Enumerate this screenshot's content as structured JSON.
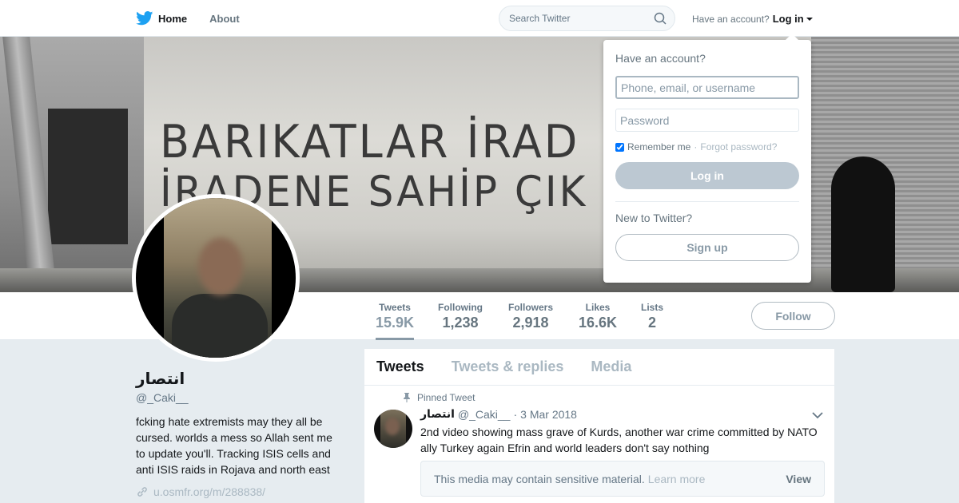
{
  "nav": {
    "home_label": "Home",
    "about_label": "About",
    "search_placeholder": "Search Twitter",
    "have_account": "Have an account?",
    "login_label": "Log in"
  },
  "banner": {
    "graffiti_line1": "BARIKATLAR İRAD",
    "graffiti_line2": "İRADENE SAHİP ÇIK"
  },
  "profile": {
    "display_name": "انتصار",
    "handle": "@_Caki__",
    "bio": "fcking hate extremists may they all be cursed. worlds a mess so Allah sent me to update you'll. Tracking ISIS cells and anti ISIS raids in Rojava and north east",
    "link": "u.osmfr.org/m/288838/"
  },
  "stats": [
    {
      "label": "Tweets",
      "value": "15.9K"
    },
    {
      "label": "Following",
      "value": "1,238"
    },
    {
      "label": "Followers",
      "value": "2,918"
    },
    {
      "label": "Likes",
      "value": "16.6K"
    },
    {
      "label": "Lists",
      "value": "2"
    }
  ],
  "follow_label": "Follow",
  "timeline": {
    "tabs": [
      "Tweets",
      "Tweets & replies",
      "Media"
    ],
    "pinned_label": "Pinned Tweet",
    "tweet": {
      "name": "انتصار",
      "handle": "@_Caki__",
      "date": "3 Mar 2018",
      "text": "2nd video showing mass grave of Kurds, another war crime committed by NATO ally Turkey again Efrin and world leaders don't say nothing",
      "sensitive_text": "This media may contain sensitive material.",
      "learn_more": "Learn more",
      "view_label": "View"
    }
  },
  "login_dropdown": {
    "title": "Have an account?",
    "username_placeholder": "Phone, email, or username",
    "password_placeholder": "Password",
    "remember_label": "Remember me",
    "separator": "·",
    "forgot_label": "Forgot password?",
    "login_button": "Log in",
    "new_label": "New to Twitter?",
    "signup_button": "Sign up"
  },
  "colors": {
    "brand_blue": "#1da1f2",
    "text_dark": "#14171a",
    "text_muted": "#657786",
    "background": "#e6ecf0"
  }
}
